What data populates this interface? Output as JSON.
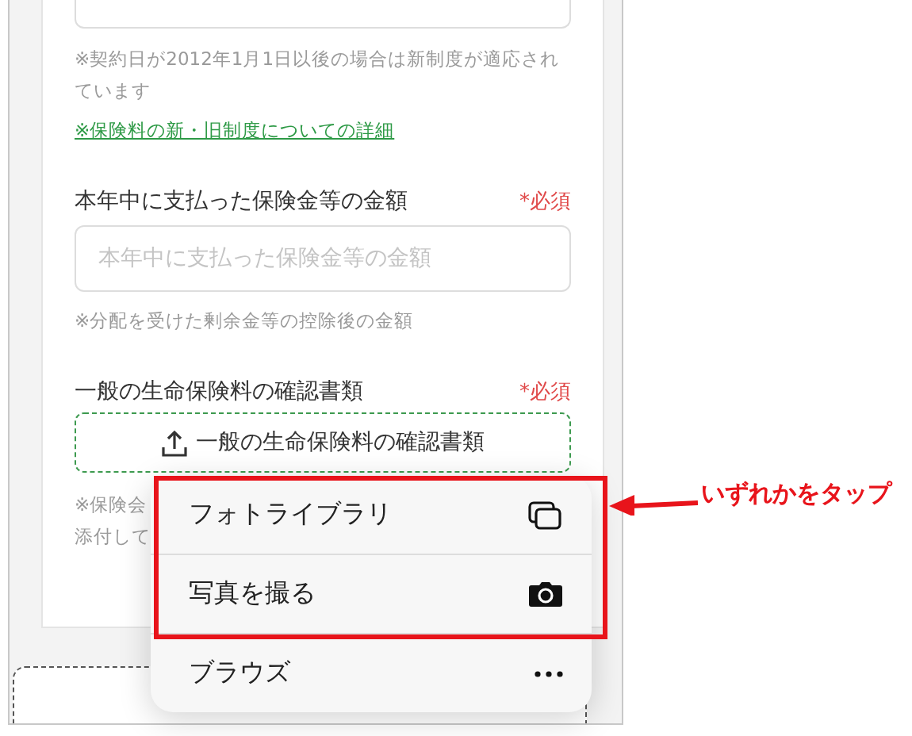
{
  "form": {
    "intro_note": "※契約日が2012年1月1日以後の場合は新制度が適応されています",
    "detail_link": "※保険料の新・旧制度についての詳細",
    "amount_field": {
      "label": "本年中に支払った保険金等の金額",
      "required": "*必須",
      "placeholder": "本年中に支払った保険金等の金額",
      "note": "※分配を受けた剰余金等の控除後の金額"
    },
    "document_field": {
      "label": "一般の生命保険料の確認書類",
      "required": "*必須",
      "upload_button": "一般の生命保険料の確認書類",
      "note_lines": [
        "※保険会",
        "添付して"
      ]
    }
  },
  "upload_menu": {
    "items": [
      {
        "label": "フォトライブラリ",
        "kind": "photos",
        "highlighted": true
      },
      {
        "label": "写真を撮る",
        "kind": "camera",
        "highlighted": true
      },
      {
        "label": "ブラウズ",
        "kind": "more",
        "highlighted": false
      }
    ]
  },
  "annotation": {
    "text": "いずれかをタップ"
  }
}
